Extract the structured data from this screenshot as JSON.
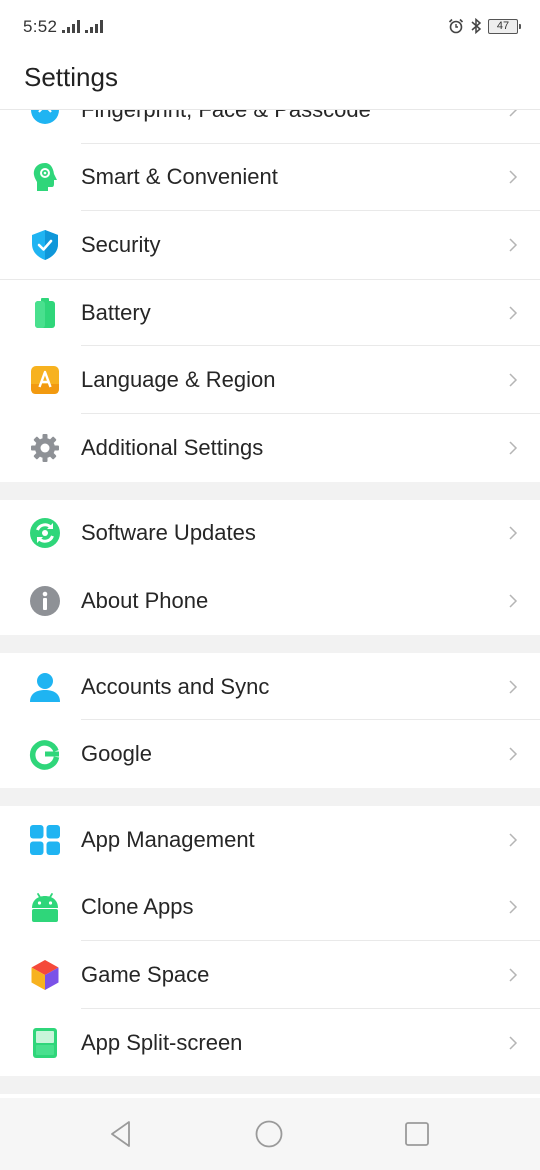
{
  "status": {
    "time": "5:52",
    "battery": "47"
  },
  "header": {
    "title": "Settings"
  },
  "items": [
    {
      "label": "Fingerprint, Face & Passcode",
      "icon": "fingerprint-icon"
    },
    {
      "label": "Smart & Convenient",
      "icon": "smart-head-icon"
    },
    {
      "label": "Security",
      "icon": "shield-icon"
    },
    {
      "label": "Battery",
      "icon": "battery-icon"
    },
    {
      "label": "Language & Region",
      "icon": "language-a-icon"
    },
    {
      "label": "Additional Settings",
      "icon": "gear-icon"
    },
    {
      "label": "Software Updates",
      "icon": "update-icon"
    },
    {
      "label": "About Phone",
      "icon": "info-icon"
    },
    {
      "label": "Accounts and Sync",
      "icon": "person-icon"
    },
    {
      "label": "Google",
      "icon": "google-icon"
    },
    {
      "label": "App Management",
      "icon": "app-grid-icon"
    },
    {
      "label": "Clone Apps",
      "icon": "android-icon"
    },
    {
      "label": "Game Space",
      "icon": "game-cube-icon"
    },
    {
      "label": "App Split-screen",
      "icon": "split-screen-icon"
    }
  ],
  "colors": {
    "accent_green": "#2fd67a",
    "accent_blue": "#1fb4f2",
    "gray_icon": "#8e9196",
    "language_orange": "#f7b21f"
  }
}
